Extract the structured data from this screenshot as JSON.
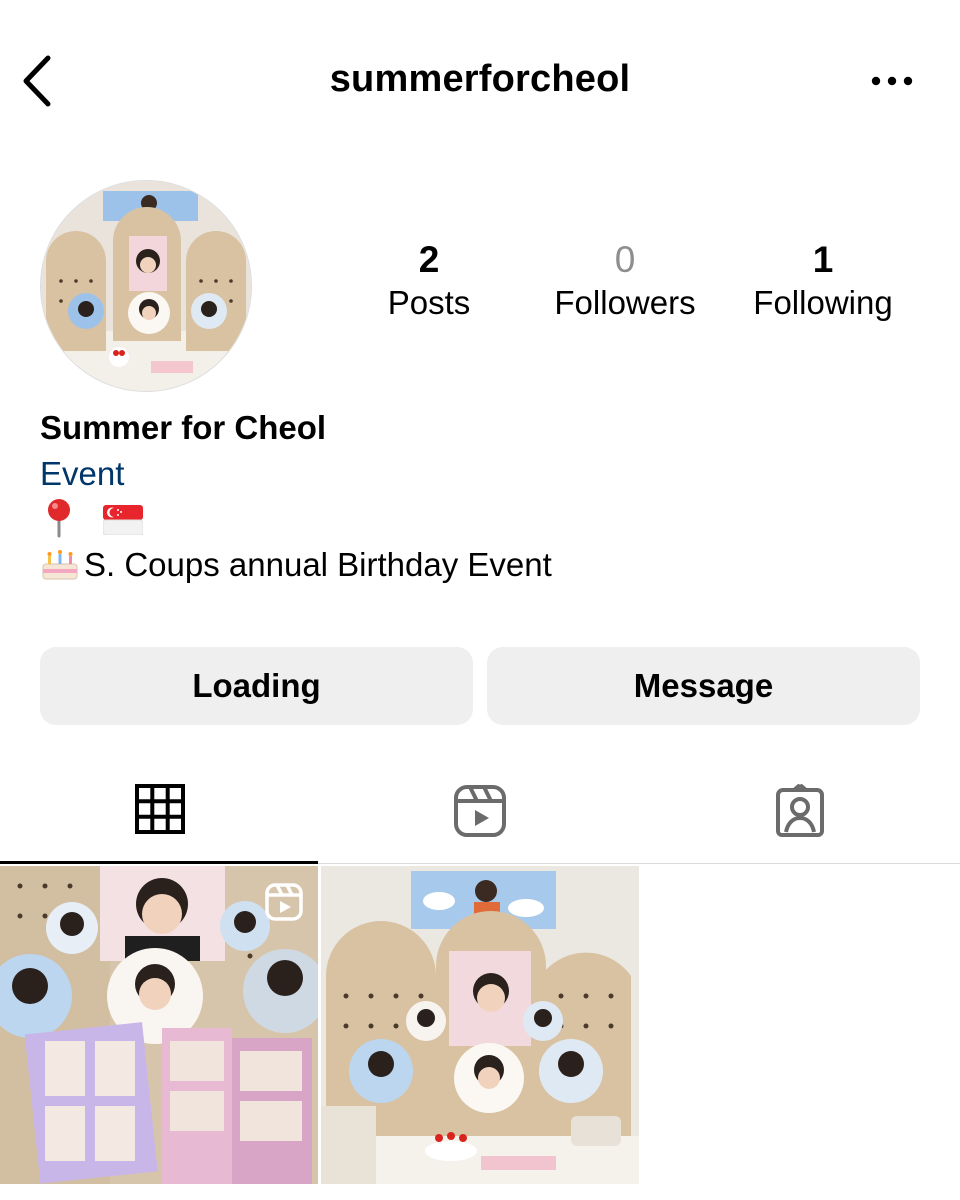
{
  "header": {
    "username": "summerforcheol",
    "icons": [
      "chevron-left-icon",
      "more-horizontal-icon"
    ]
  },
  "profile": {
    "stats": [
      {
        "value": "2",
        "label": "Posts"
      },
      {
        "value": "0",
        "label": "Followers"
      },
      {
        "value": "1",
        "label": "Following"
      }
    ],
    "display_name": "Summer for Cheol",
    "category": "Event",
    "bio_line2": "S. Coups annual Birthday Event",
    "bio_icons": [
      "round-pushpin-icon",
      "singapore-flag-icon",
      "birthday-cake-icon"
    ]
  },
  "actions": {
    "primary_label": "Loading",
    "message_label": "Message"
  },
  "tabs": [
    {
      "name": "grid",
      "icon": "grid-icon",
      "active": true
    },
    {
      "name": "reels",
      "icon": "reels-icon",
      "active": false
    },
    {
      "name": "tagged",
      "icon": "tagged-user-icon",
      "active": false
    }
  ],
  "posts": [
    {
      "type": "reel",
      "badge_icon": "reel-badge-icon"
    },
    {
      "type": "photo"
    }
  ],
  "colors": {
    "link": "#00376b",
    "button_bg": "#efefef",
    "muted": "#8e8e8e",
    "divider": "#dbdbdb"
  }
}
